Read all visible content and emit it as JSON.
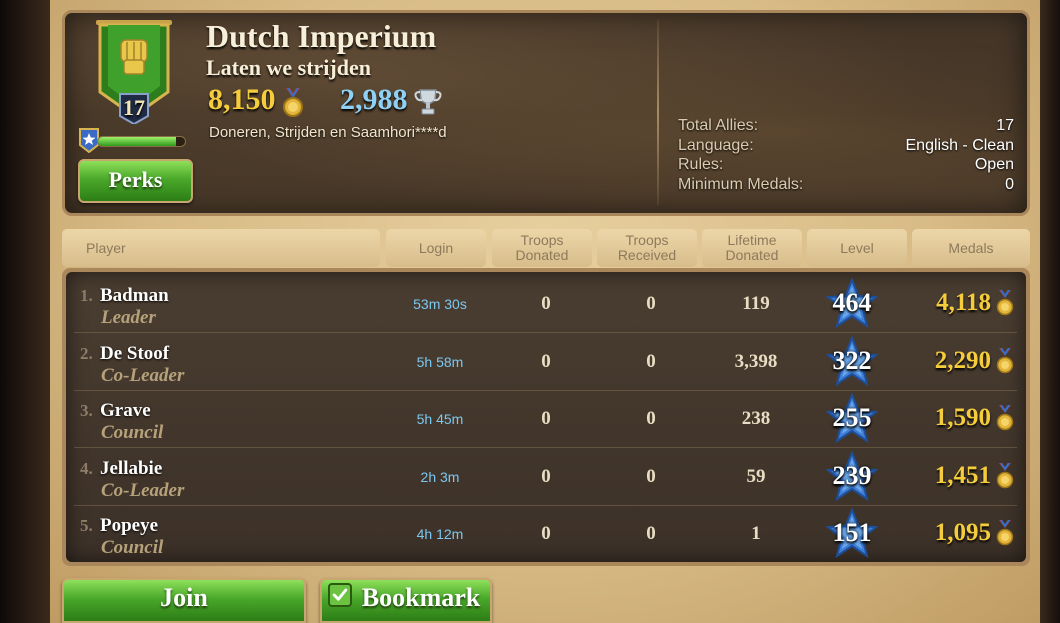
{
  "clan": {
    "name": "Dutch Imperium",
    "motto": "Laten we strijden",
    "level": "17",
    "medals": "8,150",
    "trophies": "2,988",
    "description": "Doneren, Strijden en Saamhori****d",
    "xp_progress_fraction": 0.9
  },
  "buttons": {
    "perks": "Perks",
    "join": "Join",
    "bookmark": "Bookmark"
  },
  "info": {
    "labels": [
      "Total Allies:",
      "Language:",
      "Rules:",
      "Minimum Medals:"
    ],
    "values": [
      "17",
      "English - Clean",
      "Open",
      "0"
    ]
  },
  "columns": {
    "player": "Player",
    "login": "Login",
    "troops_donated": [
      "Troops",
      "Donated"
    ],
    "troops_received": [
      "Troops",
      "Received"
    ],
    "lifetime_donated": [
      "Lifetime",
      "Donated"
    ],
    "level": "Level",
    "medals": "Medals"
  },
  "members": [
    {
      "rank": "1.",
      "name": "Badman",
      "role": "Leader",
      "login": "53m 30s",
      "donated": "0",
      "received": "0",
      "lifetime": "119",
      "level": "464",
      "medals": "4,118"
    },
    {
      "rank": "2.",
      "name": "De Stoof",
      "role": "Co-Leader",
      "login": "5h 58m",
      "donated": "0",
      "received": "0",
      "lifetime": "3,398",
      "level": "322",
      "medals": "2,290"
    },
    {
      "rank": "3.",
      "name": "Grave",
      "role": "Council",
      "login": "5h 45m",
      "donated": "0",
      "received": "0",
      "lifetime": "238",
      "level": "255",
      "medals": "1,590"
    },
    {
      "rank": "4.",
      "name": "Jellabie",
      "role": "Co-Leader",
      "login": "2h 3m",
      "donated": "0",
      "received": "0",
      "lifetime": "59",
      "level": "239",
      "medals": "1,451"
    },
    {
      "rank": "5.",
      "name": "Popeye",
      "role": "Council",
      "login": "4h 12m",
      "donated": "0",
      "received": "0",
      "lifetime": "1",
      "level": "151",
      "medals": "1,095"
    }
  ],
  "colors": {
    "accent_gold": "#f5cd3c",
    "trophy_blue": "#8fd0f5",
    "login_blue": "#7cc8f0",
    "button_green": "#4aa82a"
  },
  "icons": {
    "banner": "fist-banner-icon",
    "medal": "medal-icon",
    "trophy": "trophy-icon",
    "level": "star-icon",
    "check": "check-icon"
  }
}
